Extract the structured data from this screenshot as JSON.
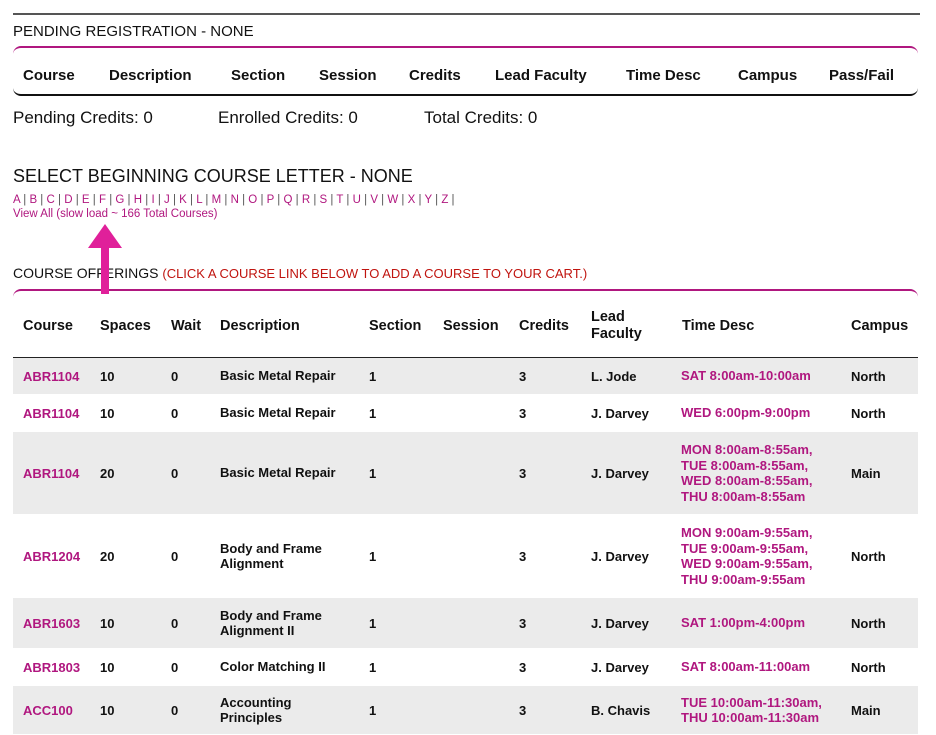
{
  "pending": {
    "title": "PENDING REGISTRATION - NONE",
    "headers": [
      "Course",
      "Description",
      "Section",
      "Session",
      "Credits",
      "Lead Faculty",
      "Time Desc",
      "Campus",
      "Pass/Fail"
    ]
  },
  "credits": {
    "pending": "Pending Credits: 0",
    "enrolled": "Enrolled Credits: 0",
    "total": "Total Credits: 0"
  },
  "letter_select": {
    "title": "SELECT BEGINNING COURSE LETTER - NONE",
    "letters": [
      "A",
      "B",
      "C",
      "D",
      "E",
      "F",
      "G",
      "H",
      "I",
      "J",
      "K",
      "L",
      "M",
      "N",
      "O",
      "P",
      "Q",
      "R",
      "S",
      "T",
      "U",
      "V",
      "W",
      "X",
      "Y",
      "Z"
    ],
    "view_all": "View All (slow load ~ 166 Total Courses)"
  },
  "offerings": {
    "title": "COURSE OFFERINGS",
    "hint": "(CLICK A COURSE LINK BELOW TO ADD A COURSE TO YOUR CART.)",
    "headers": [
      "Course",
      "Spaces",
      "Wait",
      "Description",
      "Section",
      "Session",
      "Credits",
      "Lead Faculty",
      "Time Desc",
      "Campus"
    ],
    "rows": [
      {
        "course": "ABR1104",
        "spaces": "10",
        "wait": "0",
        "description": [
          "Basic Metal Repair"
        ],
        "section": "1",
        "session": "",
        "credits": "3",
        "faculty": "L. Jode",
        "time": [
          "SAT 8:00am-10:00am"
        ],
        "campus": "North"
      },
      {
        "course": "ABR1104",
        "spaces": "10",
        "wait": "0",
        "description": [
          "Basic Metal Repair"
        ],
        "section": "1",
        "session": "",
        "credits": "3",
        "faculty": "J. Darvey",
        "time": [
          "WED 6:00pm-9:00pm"
        ],
        "campus": "North"
      },
      {
        "course": "ABR1104",
        "spaces": "20",
        "wait": "0",
        "description": [
          "Basic Metal Repair"
        ],
        "section": "1",
        "session": "",
        "credits": "3",
        "faculty": "J. Darvey",
        "time": [
          "MON 8:00am-8:55am,",
          "TUE 8:00am-8:55am,",
          "WED 8:00am-8:55am,",
          "THU 8:00am-8:55am"
        ],
        "campus": "Main"
      },
      {
        "course": "ABR1204",
        "spaces": "20",
        "wait": "0",
        "description": [
          "Body and Frame",
          "Alignment"
        ],
        "section": "1",
        "session": "",
        "credits": "3",
        "faculty": "J. Darvey",
        "time": [
          "MON 9:00am-9:55am,",
          "TUE 9:00am-9:55am,",
          "WED 9:00am-9:55am,",
          "THU 9:00am-9:55am"
        ],
        "campus": "North"
      },
      {
        "course": "ABR1603",
        "spaces": "10",
        "wait": "0",
        "description": [
          "Body and Frame",
          "Alignment II"
        ],
        "section": "1",
        "session": "",
        "credits": "3",
        "faculty": "J. Darvey",
        "time": [
          "SAT 1:00pm-4:00pm"
        ],
        "campus": "North"
      },
      {
        "course": "ABR1803",
        "spaces": "10",
        "wait": "0",
        "description": [
          "Color Matching II"
        ],
        "section": "1",
        "session": "",
        "credits": "3",
        "faculty": "J. Darvey",
        "time": [
          "SAT 8:00am-11:00am"
        ],
        "campus": "North"
      },
      {
        "course": "ACC100",
        "spaces": "10",
        "wait": "0",
        "description": [
          "Accounting",
          "Principles"
        ],
        "section": "1",
        "session": "",
        "credits": "3",
        "faculty": "B. Chavis",
        "time": [
          "TUE 10:00am-11:30am,",
          "THU 10:00am-11:30am"
        ],
        "campus": "Main"
      }
    ]
  },
  "colors": {
    "accent": "#b0177f",
    "hint": "#c0140f",
    "row_shade": "#ebebeb"
  },
  "icons": {
    "annotation_arrow": "arrow-up-icon"
  }
}
